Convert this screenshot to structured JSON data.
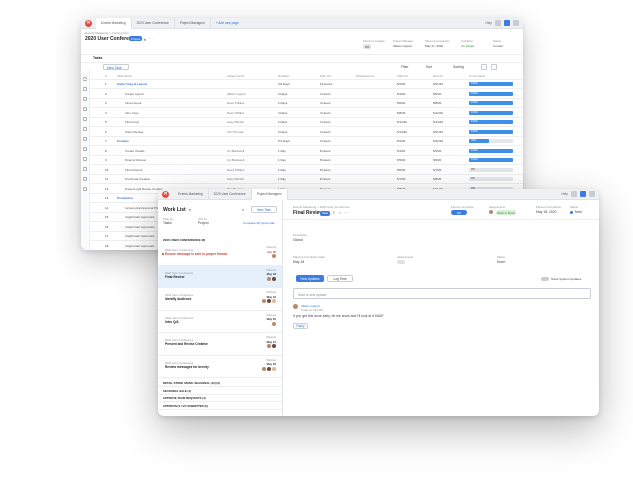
{
  "back": {
    "tabs": [
      "Events Marketing",
      "2020 User Conference",
      "Project Managers"
    ],
    "add_page": "+ Add new page",
    "tb_right_label": "Help",
    "breadcrumb": "Events Marketing > Conferences",
    "title": "2020 User Conference",
    "title_badge": "Project",
    "header_fields": [
      {
        "label": "Percent complete",
        "value": "0%"
      },
      {
        "label": "Project Manager",
        "value": "Allison Lippert"
      },
      {
        "label": "Planned completion",
        "value": "May 27, 2020"
      },
      {
        "label": "Condition",
        "value": "On Target"
      },
      {
        "label": "Status",
        "value": "Current"
      }
    ],
    "tasks_tab": "Tasks",
    "new_task": "New Task",
    "toolbar_right": [
      "Filter",
      "Sort",
      "Sorting"
    ],
    "columns": [
      "#",
      "Task Name",
      "Assignments",
      "Duration",
      "Plan Hrs",
      "Predecessors",
      "Start On",
      "Due On",
      "% Complete"
    ],
    "rows": [
      {
        "num": "1",
        "name": "Invite Copy & Layout",
        "assign": "",
        "dur": "4.8 Days",
        "hrs": "16 Hours",
        "pred": "",
        "start": "5/4/20",
        "due": "5/21/20",
        "pct": "100%",
        "group": true
      },
      {
        "num": "2",
        "name": "Create Layout",
        "assign": "Allison Lippert",
        "dur": "2 Days",
        "hrs": "3 Hours",
        "pred": "",
        "start": "5/4/20",
        "due": "5/6/20",
        "pct": "100%",
        "group": false
      },
      {
        "num": "3",
        "name": "Final Layout",
        "assign": "Dave Phillips",
        "dur": "2 Days",
        "hrs": "3 Hours",
        "pred": "",
        "start": "5/6/20",
        "due": "5/8/20",
        "pct": "100%",
        "group": false
      },
      {
        "num": "4",
        "name": "Intro Copy",
        "assign": "Dave Phillips",
        "dur": "2 Days",
        "hrs": "3 Hours",
        "pred": "",
        "start": "5/8/20",
        "due": "5/12/20",
        "pct": "100%",
        "group": false
      },
      {
        "num": "5",
        "name": "Final Copy",
        "assign": "Gary Mitchel",
        "dur": "2 Days",
        "hrs": "3 Hours",
        "pred": "",
        "start": "5/12/20",
        "due": "5/14/20",
        "pct": "100%",
        "group": false
      },
      {
        "num": "6",
        "name": "Client Review",
        "assign": "Tim Thomas",
        "dur": "2 Days",
        "hrs": "4 Hours",
        "pred": "",
        "start": "5/14/20",
        "due": "5/21/20",
        "pct": "100%",
        "group": false
      },
      {
        "num": "7",
        "name": "Creative",
        "assign": "",
        "dur": "5.6 Days",
        "hrs": "0 Hours",
        "pred": "",
        "start": "5/4/20",
        "due": "5/22/20",
        "pct": "46%",
        "group": true
      },
      {
        "num": "8",
        "name": "Create Visuals",
        "assign": "Ivy Blackwell",
        "dur": "1 Day",
        "hrs": "8 Hours",
        "pred": "",
        "start": "5/4/20",
        "due": "5/5/20",
        "pct": "100%",
        "group": false
      },
      {
        "num": "9",
        "name": "Director Review",
        "assign": "Ivy Blackwell",
        "dur": "1 Day",
        "hrs": "8 Hours",
        "pred": "",
        "start": "5/5/20",
        "due": "5/6/20",
        "pct": "100%",
        "group": false
      },
      {
        "num": "10",
        "name": "Final Artwork",
        "assign": "Dave Phillips",
        "dur": "1 Day",
        "hrs": "8 Hours",
        "pred": "",
        "start": "5/6/20",
        "due": "5/7/20",
        "pct": "0%",
        "group": false
      },
      {
        "num": "11",
        "name": "Proofread Creative",
        "assign": "Gary Mitchel",
        "dur": "1 Day",
        "hrs": "8 Hours",
        "pred": "",
        "start": "5/7/20",
        "due": "5/8/20",
        "pct": "0%",
        "group": false
      },
      {
        "num": "12",
        "name": "Present and Revise Creative",
        "assign": "Tim Thomas",
        "dur": "1 Day",
        "hrs": "8 Hours",
        "pred": "",
        "start": "5/8/20",
        "due": "5/11/20",
        "pct": "0%",
        "group": false
      },
      {
        "num": "13",
        "name": "Production",
        "assign": "",
        "dur": "",
        "hrs": "",
        "pred": "",
        "start": "",
        "due": "",
        "pct": "",
        "group": true
      },
      {
        "num": "14",
        "name": "Incremental Approval Phase",
        "assign": "",
        "dur": "",
        "hrs": "",
        "pred": "",
        "start": "",
        "due": "",
        "pct": "",
        "group": false
      },
      {
        "num": "15",
        "name": "Insightmain Approvals",
        "assign": "",
        "dur": "",
        "hrs": "",
        "pred": "",
        "start": "",
        "due": "",
        "pct": "",
        "group": false
      },
      {
        "num": "16",
        "name": "Insightmain Approvals",
        "assign": "",
        "dur": "",
        "hrs": "",
        "pred": "",
        "start": "",
        "due": "",
        "pct": "",
        "group": false
      },
      {
        "num": "17",
        "name": "Insightmain Approvals",
        "assign": "",
        "dur": "",
        "hrs": "",
        "pred": "",
        "start": "",
        "due": "",
        "pct": "",
        "group": false
      },
      {
        "num": "18",
        "name": "Insightmain Approvals",
        "assign": "",
        "dur": "",
        "hrs": "",
        "pred": "",
        "start": "",
        "due": "",
        "pct": "",
        "group": false
      }
    ]
  },
  "front": {
    "tabs": [
      "Events Marketing",
      "2020 User Conference",
      "Project Managers"
    ],
    "tb_right_label": "Help",
    "work_list_title": "Work List",
    "new_task": "New Task",
    "filter_label": "Filter by",
    "filter_value": "Tasks",
    "sort_label": "Sort by",
    "sort_value": "Project",
    "complete_link": "Complete My Approvals",
    "group_header": "2020 USER CONFERENCE (8)",
    "cards": [
      {
        "project": "2020 User Conference",
        "name": "Ensure message is sent in proper format",
        "due_label": "Planned",
        "due_date": "Apr 30",
        "alert": true
      },
      {
        "project": "2020 User Conference",
        "name": "Final Review",
        "due_label": "Planned",
        "due_date": "May 18",
        "alert": false
      },
      {
        "project": "2020 User Conference",
        "name": "Identify Audience",
        "due_label": "Planned",
        "due_date": "May 19",
        "alert": false
      },
      {
        "project": "2020 User Conference",
        "name": "Intro Q/A",
        "due_label": "Planned",
        "due_date": "May 20",
        "alert": false
      },
      {
        "project": "2020 User Conference",
        "name": "Present and Revise Creative",
        "due_label": "Planned",
        "due_date": "May 21",
        "alert": false
      },
      {
        "project": "2020 User Conference",
        "name": "Review messages for brevity",
        "due_label": "Planned",
        "due_date": "May 22",
        "alert": false
      }
    ],
    "other_groups": [
      "RETAIL STORE SIGNS: SEASONAL (10) (9)",
      "SEASONAL SALE (4)",
      "APPROVE TEAM REQUESTS (4)",
      "APPROVALS / VO SUBMITTED (5)"
    ],
    "breadcrumb": "Events Marketing > 2020 User Conference",
    "task_title": "Final Review",
    "task_badge": "Task",
    "percent_label": "Percent Complete",
    "percent_value": "0%",
    "assign_label": "Assignments",
    "assign_pill": "Work in Done",
    "planned_label": "Planned Completion",
    "planned_value": "May 18, 2020",
    "status_label": "Status",
    "status_value": "New",
    "desc_label": "Description",
    "desc_value": "Global",
    "pcd_label": "Planned Completion Date",
    "pcd_value": "May 18",
    "assigned_label": "Assignments",
    "duration_label": "Status",
    "duration_value": "None",
    "updates_tab": "New Updates",
    "log_tab": "Log Time",
    "system_toggle": "Show System Updates",
    "update_placeholder": "Start a new update",
    "comment_author": "Allison Lippert",
    "comment_meta": "Today at 1:31 PM",
    "comment_text": "If you get this done early, let me know and I'll look at it ASAP",
    "reply_label": "Reply"
  }
}
